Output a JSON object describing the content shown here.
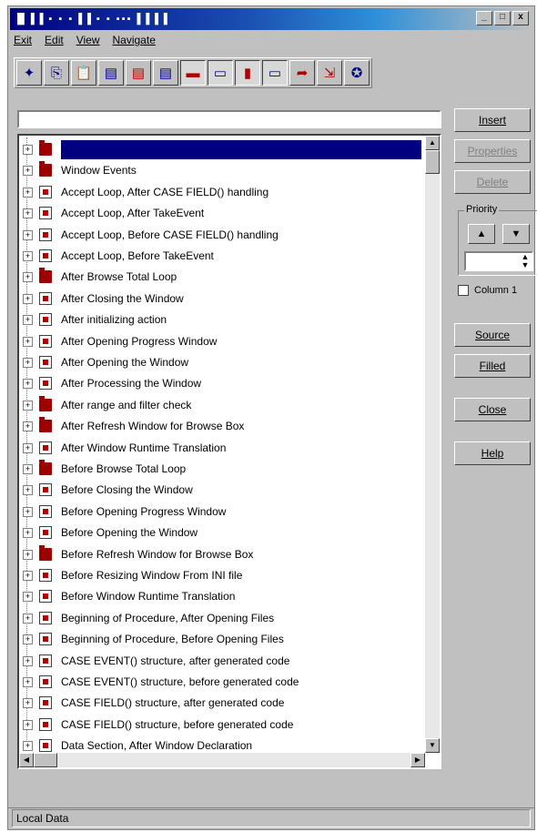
{
  "window": {
    "title": "█ ▌▌▪ ▪ ▪ ▌▌▪ ▪ ▪▪▪ ▌▌▌▌",
    "controls": [
      "_",
      "□",
      "x"
    ]
  },
  "menu": [
    "Exit",
    "Edit",
    "View",
    "Navigate"
  ],
  "toolbar": {
    "buttons": [
      {
        "name": "pointer-icon",
        "glyph": "✦"
      },
      {
        "name": "copy-icon",
        "glyph": "⎘"
      },
      {
        "name": "paste-icon",
        "glyph": "📋"
      },
      {
        "name": "doc-icon",
        "glyph": "▤"
      },
      {
        "name": "doc-red-icon",
        "glyph": "▤"
      },
      {
        "name": "doc-icon-2",
        "glyph": "▤"
      },
      {
        "name": "window-red-icon",
        "glyph": "▬"
      },
      {
        "name": "window-icon",
        "glyph": "▭"
      },
      {
        "name": "exit-red-icon",
        "glyph": "▮"
      },
      {
        "name": "window-icon-2",
        "glyph": "▭"
      },
      {
        "name": "insert-icon",
        "glyph": "➦"
      },
      {
        "name": "import-icon",
        "glyph": "⇲"
      },
      {
        "name": "globe-icon",
        "glyph": "✪"
      }
    ]
  },
  "embeds": {
    "tree_items": [
      {
        "type": "folder",
        "label": "",
        "selected": true
      },
      {
        "type": "folder",
        "label": "Window Events"
      },
      {
        "type": "page",
        "label": "Accept Loop, After CASE FIELD() handling"
      },
      {
        "type": "page",
        "label": "Accept Loop, After TakeEvent"
      },
      {
        "type": "page",
        "label": "Accept Loop, Before CASE FIELD() handling"
      },
      {
        "type": "page",
        "label": "Accept Loop, Before TakeEvent"
      },
      {
        "type": "folder",
        "label": "After Browse Total Loop"
      },
      {
        "type": "page",
        "label": "After Closing the Window"
      },
      {
        "type": "page",
        "label": "After initializing action"
      },
      {
        "type": "page",
        "label": "After Opening Progress Window"
      },
      {
        "type": "page",
        "label": "After Opening the Window"
      },
      {
        "type": "page",
        "label": "After Processing the Window"
      },
      {
        "type": "folder",
        "label": "After range and filter check"
      },
      {
        "type": "folder",
        "label": "After Refresh Window for Browse Box"
      },
      {
        "type": "page",
        "label": "After Window Runtime Translation"
      },
      {
        "type": "folder",
        "label": "Before Browse Total Loop"
      },
      {
        "type": "page",
        "label": "Before Closing the Window"
      },
      {
        "type": "page",
        "label": "Before Opening Progress Window"
      },
      {
        "type": "page",
        "label": "Before Opening the Window"
      },
      {
        "type": "folder",
        "label": "Before Refresh Window for Browse Box"
      },
      {
        "type": "page",
        "label": "Before Resizing Window From INI file"
      },
      {
        "type": "page",
        "label": "Before Window Runtime Translation"
      },
      {
        "type": "page",
        "label": "Beginning of Procedure, After Opening Files"
      },
      {
        "type": "page",
        "label": "Beginning of Procedure, Before Opening Files"
      },
      {
        "type": "page",
        "label": "CASE EVENT() structure, after generated code"
      },
      {
        "type": "page",
        "label": "CASE EVENT() structure, before generated code"
      },
      {
        "type": "page",
        "label": "CASE FIELD() structure, after generated code"
      },
      {
        "type": "page",
        "label": "CASE FIELD() structure, before generated code"
      },
      {
        "type": "page",
        "label": "Data Section, After Window Declaration"
      }
    ]
  },
  "buttons": {
    "insert": "Insert",
    "properties": "Properties",
    "delete": "Delete",
    "source": "Source",
    "filled": "Filled",
    "close": "Close",
    "help": "Help"
  },
  "priority": {
    "label": "Priority",
    "up": "▲",
    "down": "▼",
    "value": ""
  },
  "column_checkbox": {
    "label": "Column 1",
    "checked": false
  },
  "status": {
    "text": "Local Data"
  }
}
